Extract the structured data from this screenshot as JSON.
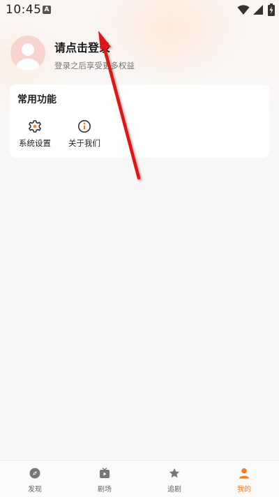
{
  "status_bar": {
    "time": "10:45",
    "notification_icon": "a-letter-icon",
    "icons": [
      "wifi-icon",
      "signal-icon",
      "battery-charging-icon"
    ]
  },
  "profile": {
    "avatar_icon": "default-avatar-icon",
    "login_title": "请点击登录",
    "login_subtitle": "登录之后享受更多权益"
  },
  "common_functions": {
    "title": "常用功能",
    "items": [
      {
        "label": "系统设置",
        "icon": "gear-icon"
      },
      {
        "label": "关于我们",
        "icon": "info-icon"
      }
    ]
  },
  "bottom_nav": {
    "items": [
      {
        "label": "发现",
        "icon": "compass-icon",
        "active": false
      },
      {
        "label": "剧场",
        "icon": "theater-icon",
        "active": false
      },
      {
        "label": "追剧",
        "icon": "star-icon",
        "active": false
      },
      {
        "label": "我的",
        "icon": "person-icon",
        "active": true
      }
    ]
  },
  "colors": {
    "accent": "#ff7a1a",
    "annotation_arrow": "#e01515",
    "avatar_bg": "#f7d5cf"
  }
}
